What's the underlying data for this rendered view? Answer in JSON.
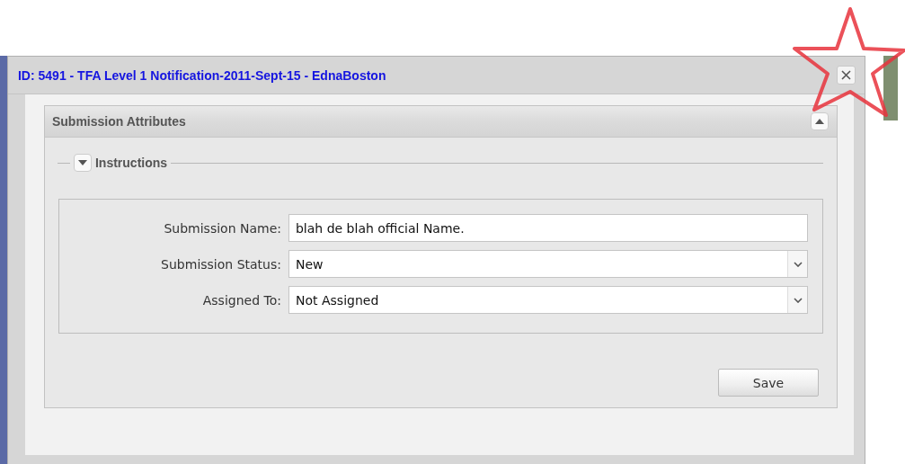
{
  "window": {
    "title": "ID: 5491 - TFA Level 1 Notification-2011-Sept-15 - EdnaBoston"
  },
  "panel": {
    "title": "Submission Attributes",
    "expanded": true,
    "section": {
      "title": "Instructions",
      "expanded": false
    },
    "fields": [
      {
        "kind": "text",
        "label": "Submission Name:",
        "value": "blah de blah official Name."
      },
      {
        "kind": "select",
        "label": "Submission Status:",
        "value": "New"
      },
      {
        "kind": "select",
        "label": "Assigned To:",
        "value": "Not Assigned"
      }
    ],
    "buttons": [
      "Save"
    ]
  }
}
